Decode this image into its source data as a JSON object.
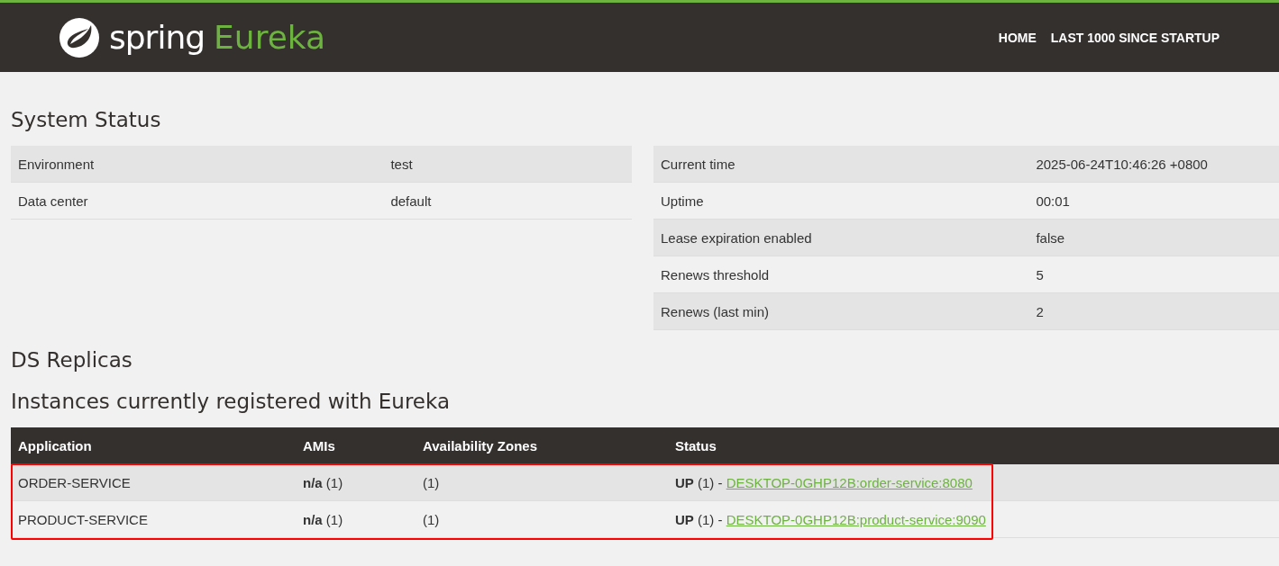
{
  "navbar": {
    "brand": "spring",
    "brand_accent": "Eureka",
    "links": [
      {
        "label": "HOME"
      },
      {
        "label": "LAST 1000 SINCE STARTUP"
      }
    ]
  },
  "system_status": {
    "title": "System Status",
    "left": [
      {
        "name": "Environment",
        "value": "test"
      },
      {
        "name": "Data center",
        "value": "default"
      }
    ],
    "right": [
      {
        "name": "Current time",
        "value": "2025-06-24T10:46:26 +0800"
      },
      {
        "name": "Uptime",
        "value": "00:01"
      },
      {
        "name": "Lease expiration enabled",
        "value": "false"
      },
      {
        "name": "Renews threshold",
        "value": "5"
      },
      {
        "name": "Renews (last min)",
        "value": "2"
      }
    ]
  },
  "ds_replicas": {
    "title": "DS Replicas"
  },
  "instances": {
    "title": "Instances currently registered with Eureka",
    "columns": [
      "Application",
      "AMIs",
      "Availability Zones",
      "Status"
    ],
    "rows": [
      {
        "application": "ORDER-SERVICE",
        "amis_label": "n/a",
        "amis_count": "(1)",
        "zones": "(1)",
        "status": "UP",
        "status_count": "(1) -",
        "instance_link": "DESKTOP-0GHP12B:order-service:8080",
        "highlighted": true
      },
      {
        "application": "PRODUCT-SERVICE",
        "amis_label": "n/a",
        "amis_count": "(1)",
        "zones": "(1)",
        "status": "UP",
        "status_count": "(1) -",
        "instance_link": "DESKTOP-0GHP12B:product-service:9090",
        "highlighted": true
      }
    ]
  }
}
